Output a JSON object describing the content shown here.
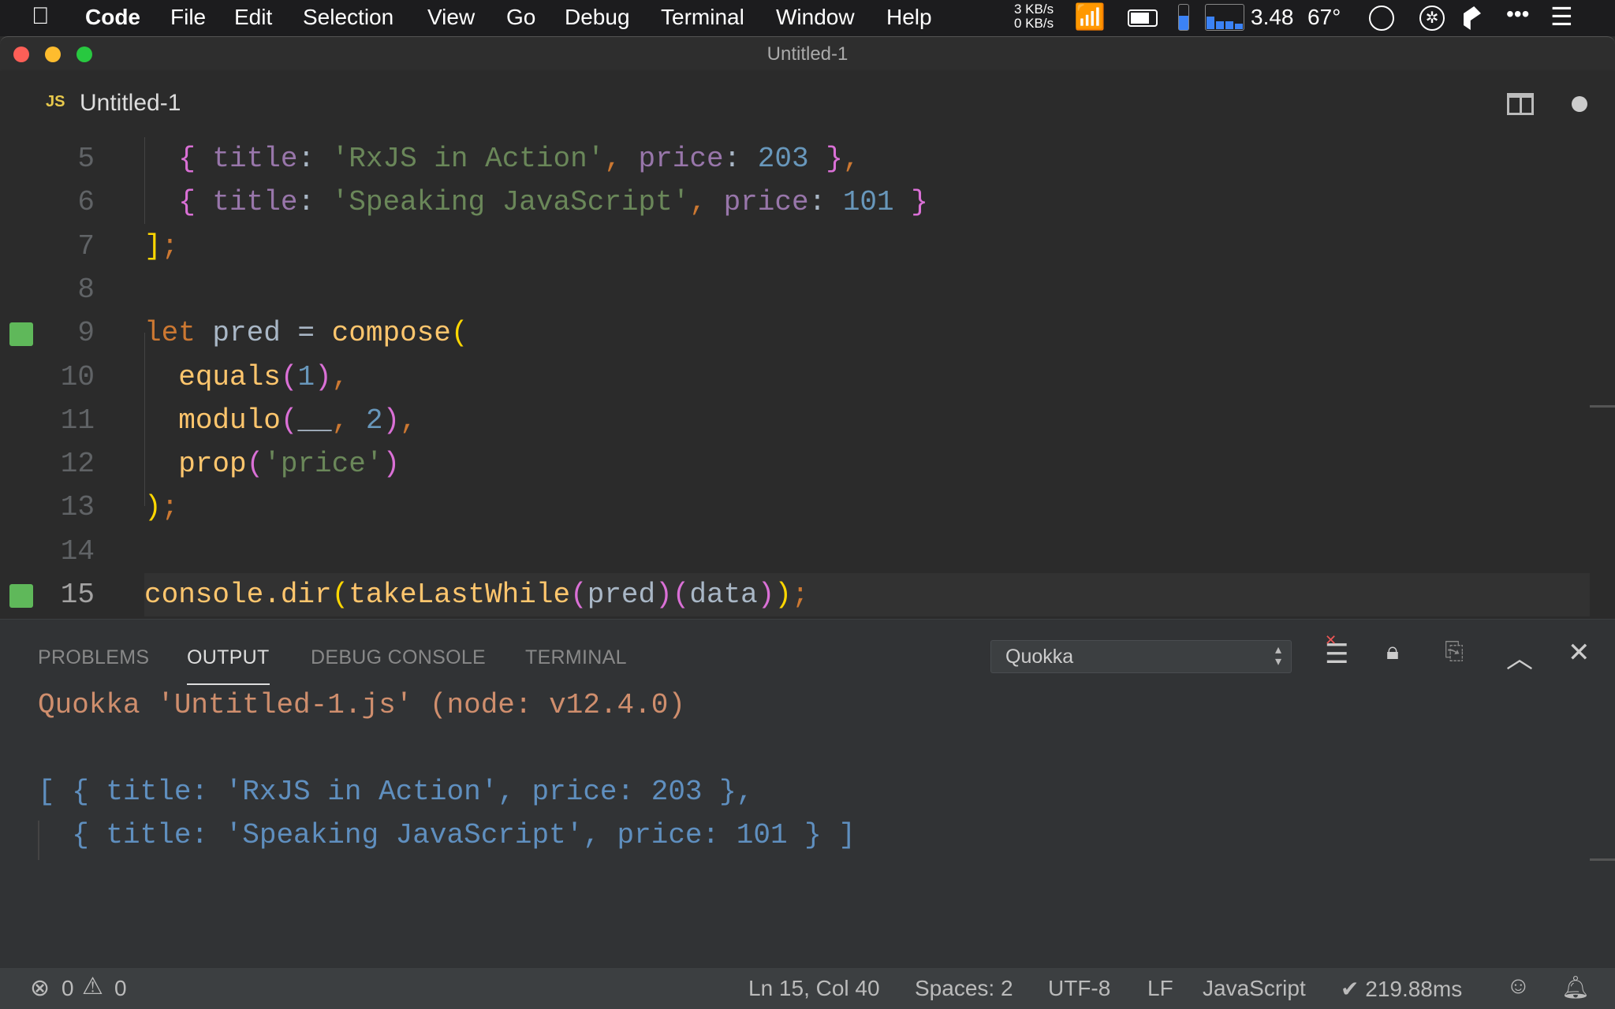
{
  "menubar": {
    "apple": "",
    "app": "Code",
    "items": [
      "File",
      "Edit",
      "Selection",
      "View",
      "Go",
      "Debug",
      "Terminal",
      "Window",
      "Help"
    ],
    "net_up": "3 KB/s",
    "net_down": "0 KB/s",
    "load": "3.48",
    "temp": "67°",
    "battery_level": 0.75,
    "mem_level": 0.55,
    "cpu_bars": [
      0.55,
      0.35,
      0.35,
      0.25
    ]
  },
  "window": {
    "title": "Untitled-1"
  },
  "tab": {
    "lang_badge": "JS",
    "label": "Untitled-1"
  },
  "editor": {
    "current_line": 15,
    "lines": [
      {
        "n": "5",
        "tokens": [
          [
            "  ",
            "plain"
          ],
          [
            "{",
            "brace"
          ],
          [
            " title",
            "prop"
          ],
          [
            ": ",
            "plain"
          ],
          [
            "'RxJS in Action'",
            "str"
          ],
          [
            ",",
            "punct"
          ],
          [
            " price",
            "prop"
          ],
          [
            ": ",
            "plain"
          ],
          [
            "203",
            "num"
          ],
          [
            " }",
            "brace"
          ],
          [
            ",",
            "punct"
          ]
        ]
      },
      {
        "n": "6",
        "tokens": [
          [
            "  ",
            "plain"
          ],
          [
            "{",
            "brace"
          ],
          [
            " title",
            "prop"
          ],
          [
            ": ",
            "plain"
          ],
          [
            "'Speaking JavaScript'",
            "str"
          ],
          [
            ",",
            "punct"
          ],
          [
            " price",
            "prop"
          ],
          [
            ": ",
            "plain"
          ],
          [
            "101",
            "num"
          ],
          [
            " }",
            "brace"
          ]
        ]
      },
      {
        "n": "7",
        "tokens": [
          [
            "]",
            "bracket"
          ],
          [
            ";",
            "punct"
          ]
        ]
      },
      {
        "n": "8",
        "tokens": []
      },
      {
        "n": "9",
        "marker": true,
        "tokens": [
          [
            "let",
            "kw"
          ],
          [
            " pred = ",
            "id"
          ],
          [
            "compose",
            "fn"
          ],
          [
            "(",
            "bracket"
          ]
        ]
      },
      {
        "n": "10",
        "tokens": [
          [
            "  ",
            "plain"
          ],
          [
            "equals",
            "fn"
          ],
          [
            "(",
            "brace"
          ],
          [
            "1",
            "num"
          ],
          [
            ")",
            "brace"
          ],
          [
            ",",
            "punct"
          ]
        ]
      },
      {
        "n": "11",
        "tokens": [
          [
            "  ",
            "plain"
          ],
          [
            "modulo",
            "fn"
          ],
          [
            "(",
            "brace"
          ],
          [
            "__",
            "id"
          ],
          [
            ",",
            "punct"
          ],
          [
            " ",
            "plain"
          ],
          [
            "2",
            "num"
          ],
          [
            ")",
            "brace"
          ],
          [
            ",",
            "punct"
          ]
        ]
      },
      {
        "n": "12",
        "tokens": [
          [
            "  ",
            "plain"
          ],
          [
            "prop",
            "fn"
          ],
          [
            "(",
            "brace"
          ],
          [
            "'price'",
            "str"
          ],
          [
            ")",
            "brace"
          ]
        ]
      },
      {
        "n": "13",
        "tokens": [
          [
            ")",
            "bracket"
          ],
          [
            ";",
            "punct"
          ]
        ]
      },
      {
        "n": "14",
        "tokens": []
      },
      {
        "n": "15",
        "marker": true,
        "tokens": [
          [
            "console.dir",
            "fn"
          ],
          [
            "(",
            "bracket"
          ],
          [
            "takeLastWhile",
            "fn"
          ],
          [
            "(",
            "brace"
          ],
          [
            "pred",
            "id"
          ],
          [
            ")",
            "brace"
          ],
          [
            "(",
            "brace"
          ],
          [
            "data",
            "id"
          ],
          [
            ")",
            "brace"
          ],
          [
            ")",
            "bracket"
          ],
          [
            ";",
            "punct"
          ]
        ]
      }
    ]
  },
  "panel": {
    "tabs": [
      "PROBLEMS",
      "OUTPUT",
      "DEBUG CONSOLE",
      "TERMINAL"
    ],
    "active_tab": "OUTPUT",
    "channel": "Quokka",
    "output": {
      "header": "Quokka 'Untitled-1.js' (node: v12.4.0)",
      "lines": [
        "[ { title: 'RxJS in Action', price: 203 },",
        "  { title: 'Speaking JavaScript', price: 101 } ]"
      ]
    }
  },
  "statusbar": {
    "errors": "0",
    "warnings": "0",
    "position": "Ln 15, Col 40",
    "spaces": "Spaces: 2",
    "encoding": "UTF-8",
    "eol": "LF",
    "language": "JavaScript",
    "timing": "✔ 219.88ms"
  },
  "colors": {
    "marker": "#5fb85a",
    "output_header": "#cf8e6d",
    "output_data": "#5f8fbf"
  }
}
